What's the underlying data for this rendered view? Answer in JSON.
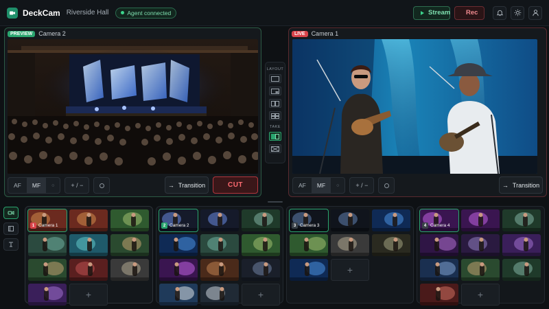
{
  "app": {
    "name": "DeckCam",
    "venue": "Riverside Hall",
    "agent_status": "Agent connected"
  },
  "header": {
    "stream_label": "Stream",
    "rec_label": "Rec"
  },
  "preview": {
    "tag": "PREVIEW",
    "camera": "Camera 2",
    "af": "AF",
    "mf": "MF",
    "zoom": "+ / −",
    "transition": "Transition",
    "cut": "CUT"
  },
  "live": {
    "tag": "LIVE",
    "camera": "Camera 1",
    "af": "AF",
    "mf": "MF",
    "zoom": "+ / −",
    "transition": "Transition"
  },
  "layout_panel": {
    "layout_label": "LAYOUT",
    "take_label": "TAKE"
  },
  "colors": {
    "preview": "#2aa56f",
    "live": "#d9434a",
    "background": "#0e1114"
  },
  "groups": [
    {
      "number": "1",
      "camera": "Camera 1",
      "thumbs": [
        "stage-duo",
        "stage-duo",
        "guitar",
        "ukulele",
        "ukulele-teal",
        "guitar-hat",
        "guitar-hat",
        "hat-red",
        "guitar-sit",
        "guitar-purple"
      ],
      "add": "+"
    },
    {
      "number": "2",
      "camera": "Camera 2",
      "thumbs": [
        "wide",
        "wide",
        "duo",
        "wide-blue",
        "ukulele",
        "guitar",
        "purple",
        "guitar-warm",
        "duo-dark",
        "white-jacket",
        "hat"
      ],
      "add": "+"
    },
    {
      "number": "3",
      "camera": "Camera 3",
      "thumbs": [
        "wide-dark",
        "wide-dark",
        "wide-blue",
        "guitar",
        "guitar-sit",
        "guitar-stand",
        "wide-blue"
      ],
      "add": "+"
    },
    {
      "number": "4",
      "camera": "Camera 4",
      "thumbs": [
        "purple",
        "purple",
        "duo",
        "purple-sit",
        "hat-purple",
        "guitar-purple",
        "guitar-blue",
        "guitar-hat",
        "duo",
        "red-hat"
      ],
      "add": "+"
    }
  ]
}
